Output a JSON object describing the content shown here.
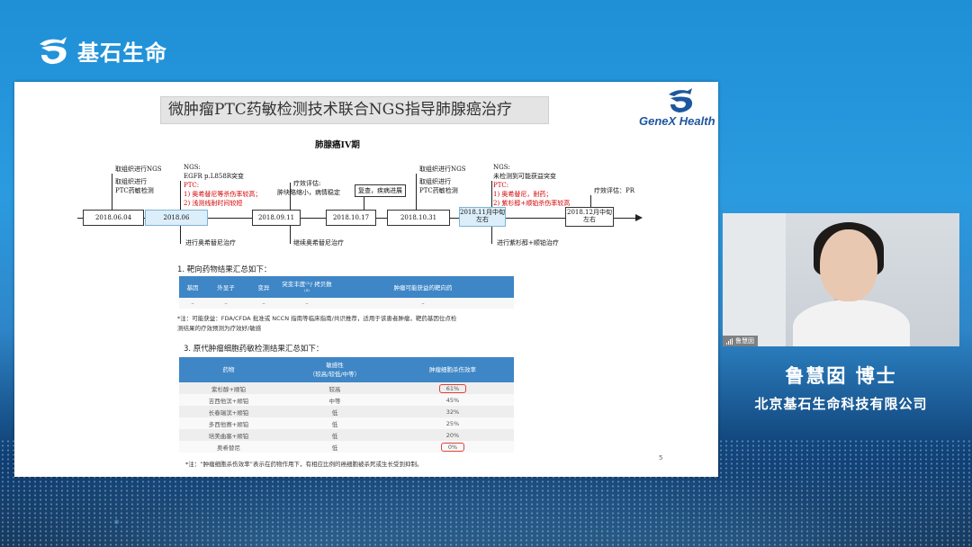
{
  "brand": {
    "name": "基石生命"
  },
  "slide": {
    "title": "微肿瘤PTC药敏检测技术联合NGS指导肺腺癌治疗",
    "logo_text": "GeneX Health",
    "stage": "肺腺癌IV期",
    "page": "5",
    "timeline": {
      "dates": [
        "2018.06.04",
        "2018.06",
        "2018.09.11",
        "2018.10.17",
        "2018.10.31",
        "2018.11月中旬",
        "左右",
        "2018.12月中旬",
        "左右"
      ],
      "above": {
        "n1": [
          "取组织进行NGS",
          "取组织进行",
          "PTC药敏检测"
        ],
        "n2": [
          "NGS:",
          "EGFR p.L858R突变",
          "PTC:"
        ],
        "n2_red": [
          "1) 奥希替尼等杀伤率较高；",
          "2) 浅测线耐时间较短"
        ],
        "n3": [
          "疗效评估:",
          "肿块略缩小，病情稳定"
        ],
        "n4": "复查，疾病进展",
        "n5": [
          "取组织进行NGS",
          "取组织进行",
          "PTC药敏检测"
        ],
        "n6": [
          "NGS:",
          "未检测到可能获益突变",
          "PTC:"
        ],
        "n6_red": [
          "1) 奥希替尼，耐药；",
          "2) 紫杉醇+顺铂杀伤率较高"
        ],
        "n7": "疗效评估：PR"
      },
      "below": {
        "b1": "进行奥希替尼治疗",
        "b2": "继续奥希替尼治疗",
        "b3": "进行紫杉醇+顺铂治疗"
      }
    },
    "section1": {
      "title": "1. 靶向药物结果汇总如下：",
      "headers": [
        "基因",
        "外显子",
        "变异",
        "突变丰度⁽¹⁾/ 拷贝数⁽²⁾",
        "肿瘤可能获益的靶向药"
      ],
      "row": [
        "–",
        "–",
        "–",
        "–",
        "–"
      ],
      "footnote": [
        "*注：可能获益：FDA/CFDA 批准或 NCCN 指南等临床指南/共识推荐，适用于该患者肿瘤，靶药基因位点检",
        "测结果的疗效预测为疗效好/敏感"
      ]
    },
    "section3": {
      "title": "3. 原代肿瘤细胞药敏检测结果汇总如下：",
      "headers": [
        "药物",
        "敏感性",
        "（较高/较低/中等）",
        "肿瘤细胞杀伤效率"
      ],
      "rows": [
        {
          "drug": "紫杉醇+顺铂",
          "sens": "较高",
          "eff": "61%",
          "circled": true
        },
        {
          "drug": "吉西他滨+顺铂",
          "sens": "中等",
          "eff": "45%",
          "circled": false
        },
        {
          "drug": "长春瑞滨+顺铂",
          "sens": "低",
          "eff": "32%",
          "circled": false
        },
        {
          "drug": "多西他赛+顺铂",
          "sens": "低",
          "eff": "25%",
          "circled": false
        },
        {
          "drug": "培美曲塞+顺铂",
          "sens": "低",
          "eff": "20%",
          "circled": false
        },
        {
          "drug": "奥希替尼",
          "sens": "低",
          "eff": "0%",
          "circled": true
        }
      ],
      "footnote": "*注：“肿瘤细胞杀伤效率”表示在药物作用下，有相应比例的癌细胞被杀死或生长受到抑制。"
    }
  },
  "speaker": {
    "video_tag": "鲁慧囡",
    "name": "鲁慧囡 博士",
    "org": "北京基石生命科技有限公司"
  },
  "colors": {
    "accent": "#3e86c6",
    "red": "#d40000",
    "highlight": "#dceefa"
  },
  "icons": [
    "brand-logo-icon",
    "genex-logo-icon",
    "signal-icon"
  ]
}
